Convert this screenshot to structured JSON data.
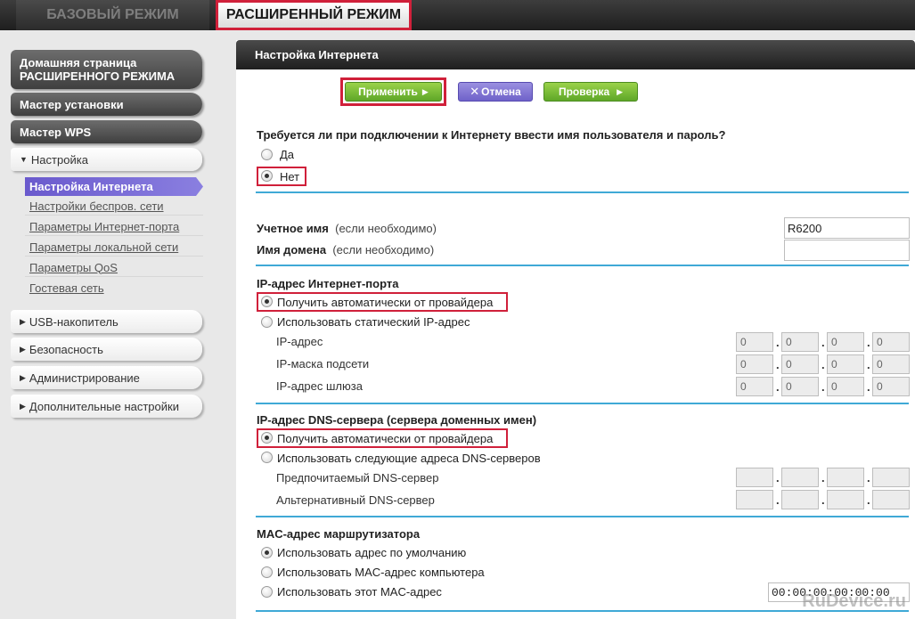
{
  "tabs": {
    "basic": "БАЗОВЫЙ РЕЖИМ",
    "advanced": "РАСШИРЕННЫЙ РЕЖИМ"
  },
  "sidebar": {
    "home_line1": "Домашняя страница",
    "home_line2": "РАСШИРЕННОГО РЕЖИМА",
    "wizard": "Мастер установки",
    "wps": "Мастер WPS",
    "setup": "Настройка",
    "sub_items": [
      "Настройка Интернета",
      "Настройки беспров. сети",
      "Параметры Интернет-порта",
      "Параметры локальной сети",
      "Параметры QoS",
      "Гостевая сеть"
    ],
    "usb": "USB-накопитель",
    "security": "Безопасность",
    "admin": "Администрирование",
    "advanced_settings": "Дополнительные настройки"
  },
  "main": {
    "title": "Настройка Интернета",
    "buttons": {
      "apply": "Применить",
      "cancel": "Отмена",
      "test": "Проверка"
    },
    "login_question": "Требуется ли при подключении к Интернету ввести имя пользователя и пароль?",
    "login_yes": "Да",
    "login_no": "Нет",
    "account_label": "Учетное имя",
    "domain_label": "Имя домена",
    "optional_hint": "(если необходимо)",
    "account_value": "R6200",
    "domain_value": "",
    "ip_section": "IP-адрес Интернет-порта",
    "ip_auto": "Получить автоматически от провайдера",
    "ip_static": "Использовать статический IP-адрес",
    "ip_address": "IP-адрес",
    "ip_mask": "IP-маска подсети",
    "ip_gateway": "IP-адрес шлюза",
    "ip_values": {
      "address": [
        "0",
        "0",
        "0",
        "0"
      ],
      "mask": [
        "0",
        "0",
        "0",
        "0"
      ],
      "gateway": [
        "0",
        "0",
        "0",
        "0"
      ]
    },
    "dns_section": "IP-адрес DNS-сервера (сервера доменных имен)",
    "dns_auto": "Получить автоматически от провайдера",
    "dns_manual": "Использовать следующие адреса DNS-серверов",
    "dns_primary": "Предпочитаемый DNS-сервер",
    "dns_secondary": "Альтернативный DNS-сервер",
    "mac_section": "MAC-адрес маршрутизатора",
    "mac_default": "Использовать адрес по умолчанию",
    "mac_computer": "Использовать MAC-адрес компьютера",
    "mac_this": "Использовать этот MAC-адрес",
    "mac_value": "00:00:00:00:00:00"
  },
  "watermark": "RuDevice.ru",
  "colors": {
    "highlight_red": "#d0203a",
    "divider_blue": "#3fa9d6",
    "active_purple": "#6a5acd",
    "button_green": "#5fa728"
  }
}
